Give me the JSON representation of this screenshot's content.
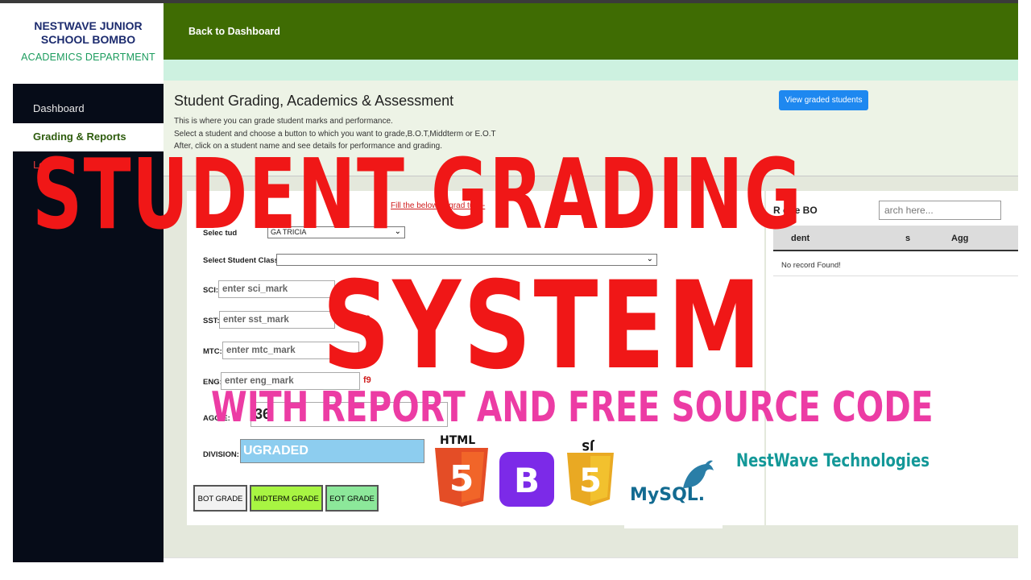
{
  "sidebar": {
    "school_line1": "NESTWAVE JUNIOR",
    "school_line2": "SCHOOL BOMBO",
    "department": "ACADEMICS DEPARTMENT",
    "items": [
      {
        "label": "Dashboard"
      },
      {
        "label": "Grading & Reports"
      },
      {
        "label": "Lo"
      }
    ]
  },
  "header": {
    "back_label": "Back to Dashboard"
  },
  "intro": {
    "title": "Student Grading, Academics & Assessment",
    "line1": "This is where you can grade student marks and performance.",
    "line2": "Select a student and choose a button to which you want to grade,B.O.T,Middterm or E.O.T",
    "line3": "After, click on a student name and see details for performance and grading.",
    "view_button": "View graded students"
  },
  "form": {
    "fill_note": "Fill the     below to grad     tu      s  -  ",
    "student_label": "Selec   tud",
    "student_value": "GA  TRICIA",
    "class_label": "Select Student Class",
    "class_value": "",
    "fields": [
      {
        "label": "SCI:",
        "placeholder": "enter sci_mark",
        "hint": ""
      },
      {
        "label": "SST:",
        "placeholder": "enter sst_mark",
        "hint": "f9"
      },
      {
        "label": "MTC:",
        "placeholder": "enter mtc_mark",
        "hint": ""
      },
      {
        "label": "ENG:",
        "placeholder": "enter eng_mark",
        "hint": "f9"
      }
    ],
    "aggregate_label": "AGG    E:",
    "aggregate_value": "36",
    "division_label": "DIVISION:",
    "division_value": "UGRADED",
    "buttons": {
      "bot": "BOT GRADE",
      "midterm": "MIDTERM GRADE",
      "eot": "EOT GRADE"
    }
  },
  "records": {
    "search_label": "R      ode   BO",
    "search_placeholder": "arch here...",
    "columns": [
      "dent",
      "s",
      "Agg"
    ],
    "empty": "No record Found!"
  },
  "overlay": {
    "title_line1": "STUDENT GRADING",
    "title_line2": "SYSTEM",
    "subtitle": "WITH REPORT AND FREE SOURCE CODE",
    "company": "NestWave Technologies",
    "logos": {
      "html": "HTML",
      "bootstrap": "B",
      "js": "JS",
      "mysql": "MySQL."
    }
  },
  "colors": {
    "header_green": "#3f6c03",
    "sidebar": "#060c18",
    "accent_blue": "#1e88f0",
    "midterm_btn": "#a8f542",
    "eot_btn": "#8ce89a",
    "overlay_red": "#f01717",
    "overlay_pink": "#ec3ca4",
    "company_teal": "#139898"
  }
}
